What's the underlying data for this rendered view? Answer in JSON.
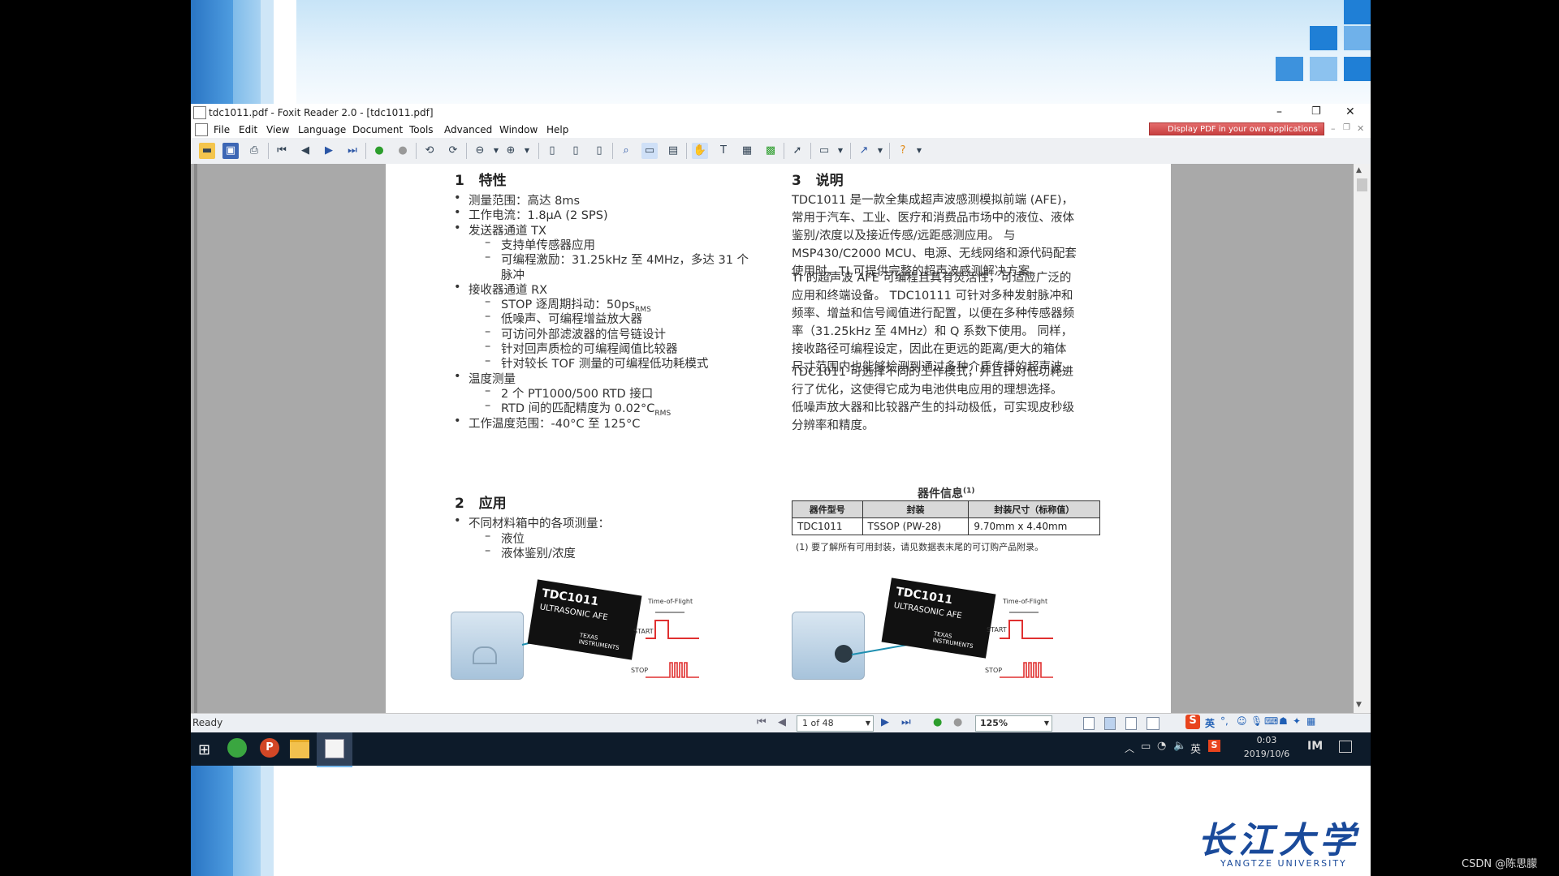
{
  "window": {
    "title": "tdc1011.pdf - Foxit Reader 2.0 - [tdc1011.pdf]",
    "ad_banner": "Display PDF in your own applications",
    "controls": {
      "minimize": "–",
      "maximize": "❐",
      "close": "✕"
    }
  },
  "menu": [
    "File",
    "Edit",
    "View",
    "Language",
    "Document",
    "Tools",
    "Advanced",
    "Window",
    "Help"
  ],
  "pdf": {
    "sec1": {
      "num": "1",
      "title": "特性"
    },
    "features": [
      {
        "type": "bullet",
        "text": "测量范围：高达 8ms"
      },
      {
        "type": "bullet",
        "text": "工作电流：1.8μA (2 SPS)"
      },
      {
        "type": "bullet",
        "text": "发送器通道 TX"
      },
      {
        "type": "dash",
        "text": "支持单传感器应用"
      },
      {
        "type": "dash",
        "text": "可编程激励：31.25kHz 至 4MHz，多达 31 个"
      },
      {
        "type": "cont",
        "text": "脉冲"
      },
      {
        "type": "bullet",
        "text": "接收器通道 RX"
      },
      {
        "type": "dash",
        "text": "STOP 逐周期抖动：50ps"
      },
      {
        "type": "dash",
        "text": "低噪声、可编程增益放大器"
      },
      {
        "type": "dash",
        "text": "可访问外部滤波器的信号链设计"
      },
      {
        "type": "dash",
        "text": "针对回声质检的可编程阈值比较器"
      },
      {
        "type": "dash",
        "text": "针对较长 TOF 测量的可编程低功耗模式"
      },
      {
        "type": "bullet",
        "text": "温度测量"
      },
      {
        "type": "dash",
        "text": "2 个 PT1000/500 RTD 接口"
      },
      {
        "type": "dash",
        "text": "RTD 间的匹配精度为 0.02°C"
      },
      {
        "type": "bullet",
        "text": "工作温度范围：-40°C 至 125°C"
      }
    ],
    "stop_jitter_sub": "RMS",
    "rtd_sub": "RMS",
    "sec2": {
      "num": "2",
      "title": "应用"
    },
    "applications": [
      {
        "type": "bullet",
        "text": "不同材料箱中的各项测量："
      },
      {
        "type": "dash",
        "text": "液位"
      },
      {
        "type": "dash",
        "text": "液体鉴别/浓度"
      }
    ],
    "sec3": {
      "num": "3",
      "title": "说明"
    },
    "desc": [
      [
        "TDC1011 是一款全集成超声波感测模拟前端 (AFE)，",
        "常用于汽车、工业、医疗和消费品市场中的液位、液体",
        "鉴别/浓度以及接近传感/远距感测应用。 与",
        "MSP430/C2000 MCU、电源、无线网络和源代码配套",
        "使用时，TI 可提供完整的超声波感测解决方案。"
      ],
      [
        "TI 的超声波 AFE 可编程且具有灵活性，可适应广泛的",
        "应用和终端设备。 TDC10111 可针对多种发射脉冲和",
        "频率、增益和信号阈值进行配置，以便在多种传感器频",
        "率（31.25kHz 至 4MHz）和 Q 系数下使用。 同样，",
        "接收路径可编程设定，因此在更远的距离/更大的箱体",
        "尺寸范围内也能够检测到通过多种介质传播的超声波。"
      ],
      [
        "TDC1011 可选择不同的工作模式，并且针对低功耗进",
        "行了优化，这使得它成为电池供电应用的理想选择。",
        "低噪声放大器和比较器产生的抖动极低，可实现皮秒级",
        "分辨率和精度。"
      ]
    ],
    "device_info": {
      "title": "器件信息",
      "footnote_mark": "(1)",
      "headers": [
        "器件型号",
        "封装",
        "封装尺寸（标称值）"
      ],
      "row": [
        "TDC1011",
        "TSSOP (PW-28)",
        "9.70mm x 4.40mm"
      ],
      "footnote": "(1)  要了解所有可用封装，请见数据表末尾的可订购产品附录。"
    },
    "figure": {
      "chip_name": "TDC1011",
      "chip_sub": "ULTRASONIC AFE",
      "brand": "TEXAS INSTRUMENTS",
      "tof": "Time-of-Flight",
      "start": "START",
      "stop": "STOP"
    }
  },
  "status": {
    "text": "Ready",
    "page": "1 of 48",
    "zoom": "125%"
  },
  "ime": {
    "lang": "英"
  },
  "taskbar": {
    "tray_lang": "英",
    "time": "0:03",
    "date": "2019/10/6"
  },
  "footer": {
    "school_cn": "长江大学",
    "school_en": "YANGTZE UNIVERSITY",
    "watermark": "CSDN @陈思朦"
  },
  "colors": {
    "accent_blue": "#1f7fd6",
    "slide_bar_dark": "#1d6fc0",
    "taskbar": "#0d1b2a"
  }
}
